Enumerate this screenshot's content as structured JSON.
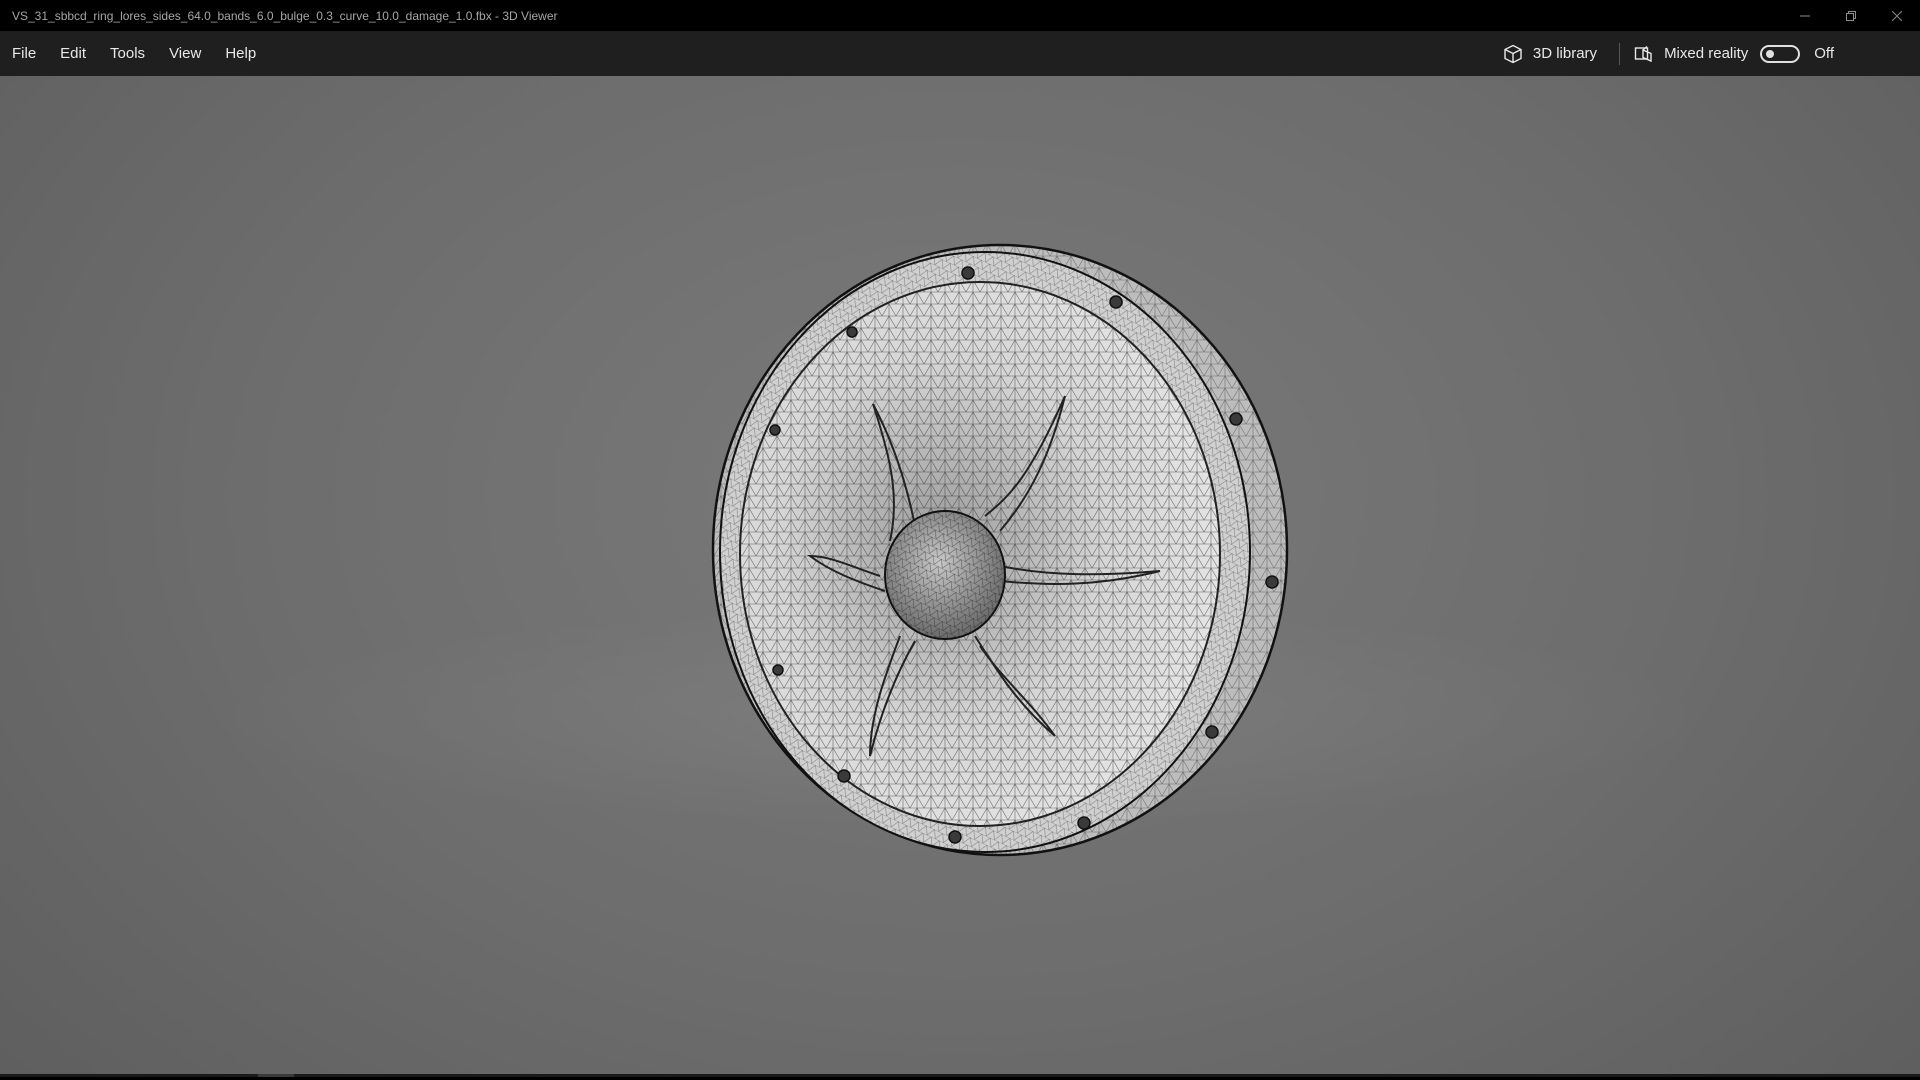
{
  "window": {
    "title": "VS_31_sbbcd_ring_lores_sides_64.0_bands_6.0_bulge_0.3_curve_10.0_damage_1.0.fbx - 3D Viewer",
    "controls": [
      "minimize-icon",
      "restore-icon",
      "close-icon"
    ]
  },
  "menu": {
    "items": [
      "File",
      "Edit",
      "Tools",
      "View",
      "Help"
    ]
  },
  "commands": {
    "library_label": "3D library",
    "library_icon": "cube-icon",
    "mixed_reality_label": "Mixed reality",
    "mixed_reality_icon": "mixed-reality-icon",
    "mixed_reality_state": "Off"
  },
  "colors": {
    "titlebar": "#000000",
    "menubar": "#1f1f1f",
    "viewport": "#707070",
    "mesh_surface": "#d9d9d9",
    "wire": "#1a1a1a"
  }
}
